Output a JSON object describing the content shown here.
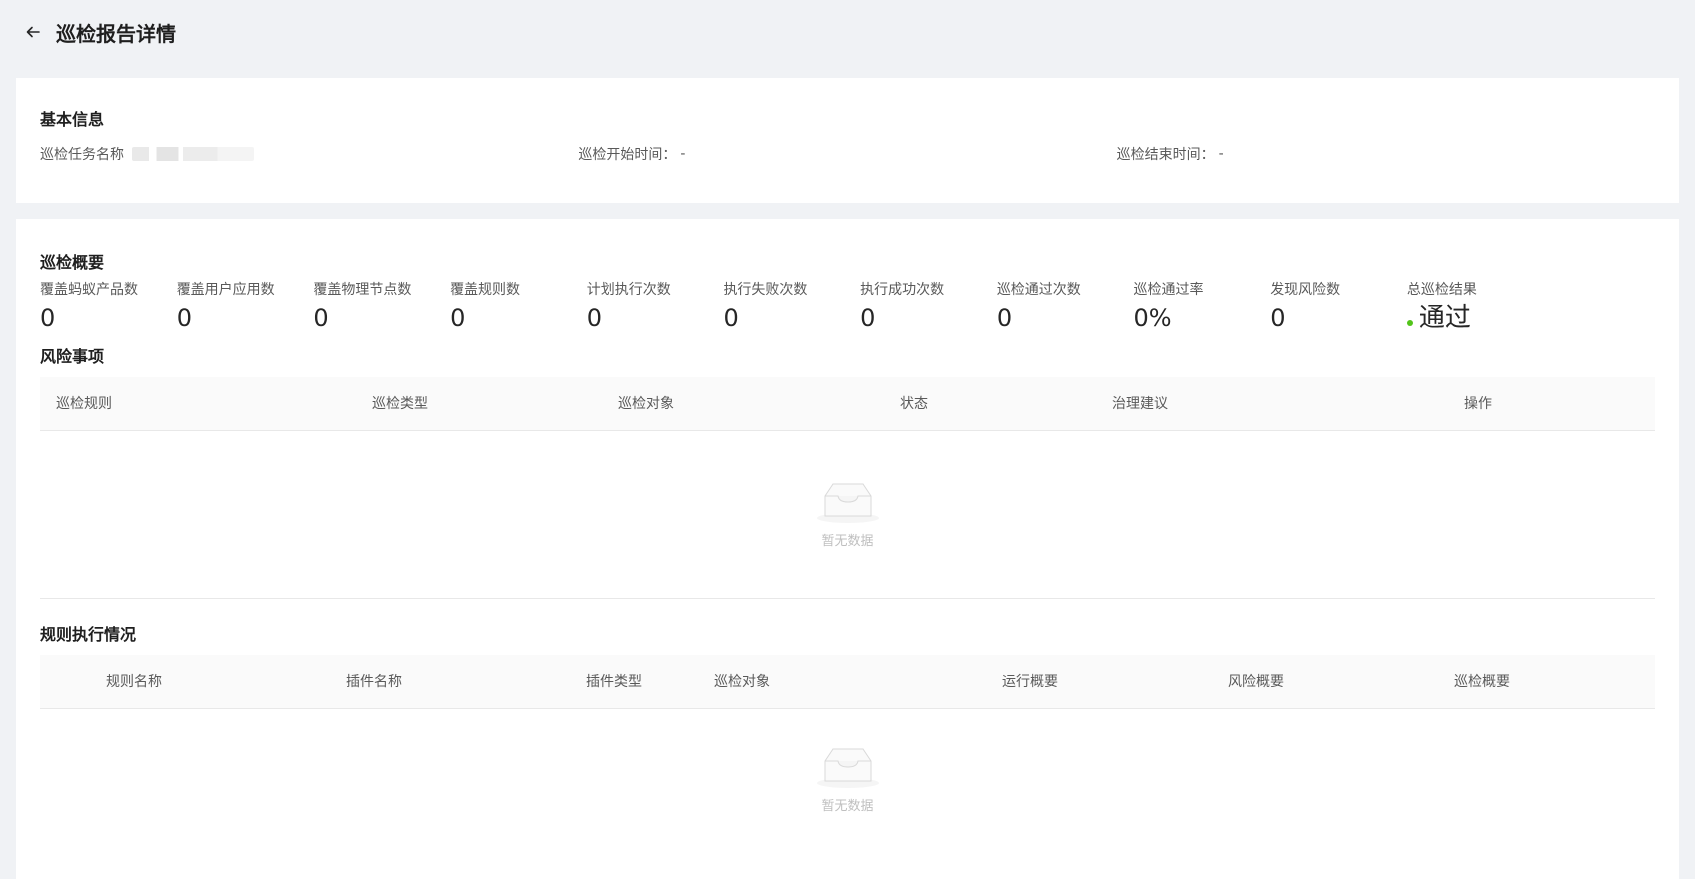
{
  "header": {
    "title": "巡检报告详情",
    "back_icon": "arrow-left-icon"
  },
  "basic_info": {
    "title": "基本信息",
    "task_name_label": "巡检任务名称",
    "start_time_label": "巡检开始时间：",
    "start_time_value": "-",
    "end_time_label": "巡检结束时间：",
    "end_time_value": "-"
  },
  "overview": {
    "title": "巡检概要",
    "stats": [
      {
        "label": "覆盖蚂蚁产品数",
        "value": "0"
      },
      {
        "label": "覆盖用户应用数",
        "value": "0"
      },
      {
        "label": "覆盖物理节点数",
        "value": "0"
      },
      {
        "label": "覆盖规则数",
        "value": "0"
      },
      {
        "label": "计划执行次数",
        "value": "0"
      },
      {
        "label": "执行失败次数",
        "value": "0"
      },
      {
        "label": "执行成功次数",
        "value": "0"
      },
      {
        "label": "巡检通过次数",
        "value": "0"
      },
      {
        "label": "巡检通过率",
        "value": "0%"
      },
      {
        "label": "发现风险数",
        "value": "0"
      }
    ],
    "result_label": "总巡检结果",
    "result_value": "通过",
    "result_color": "#52c41a"
  },
  "risks": {
    "title": "风险事项",
    "columns": [
      "巡检规则",
      "巡检类型",
      "巡检对象",
      "状态",
      "治理建议",
      "操作"
    ],
    "empty_text": "暂无数据"
  },
  "rules": {
    "title": "规则执行情况",
    "columns": [
      "规则名称",
      "插件名称",
      "插件类型",
      "巡检对象",
      "运行概要",
      "风险概要",
      "巡检概要"
    ],
    "empty_text": "暂无数据"
  }
}
